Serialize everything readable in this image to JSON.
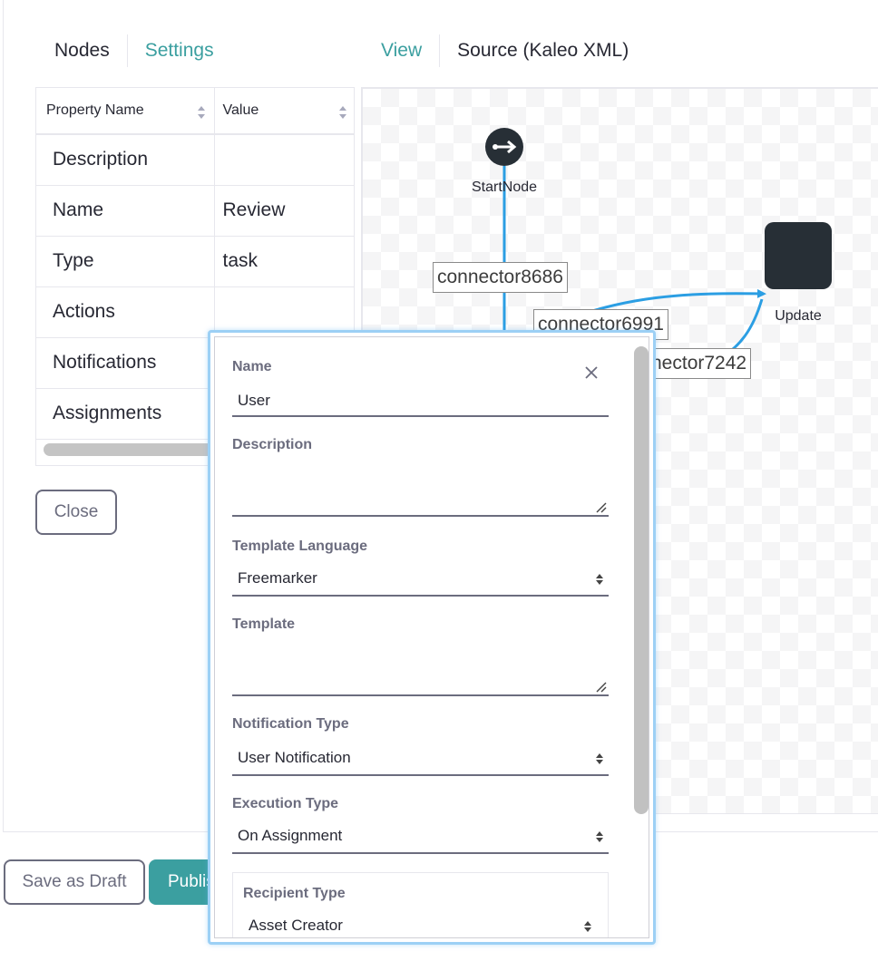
{
  "tabs_left": {
    "nodes": "Nodes",
    "settings": "Settings"
  },
  "tabs_right": {
    "view": "View",
    "source": "Source (Kaleo XML)"
  },
  "properties": {
    "columns": [
      "Property Name",
      "Value"
    ],
    "rows": [
      {
        "name": "Description",
        "value": ""
      },
      {
        "name": "Name",
        "value": "Review"
      },
      {
        "name": "Type",
        "value": "task"
      },
      {
        "name": "Actions",
        "value": ""
      },
      {
        "name": "Notifications",
        "value": ""
      },
      {
        "name": "Assignments",
        "value": ""
      }
    ]
  },
  "close_label": "Close",
  "diagram": {
    "start_label": "StartNode",
    "update_label": "Update",
    "connectors": [
      "connector8686",
      "connector6991",
      "nector7242"
    ],
    "accent": "#2b9ee3"
  },
  "footer": {
    "save_draft": "Save as Draft",
    "publish": "Publis"
  },
  "notification_form": {
    "name_label": "Name",
    "name_value": "User",
    "description_label": "Description",
    "description_value": "",
    "template_language_label": "Template Language",
    "template_language_value": "Freemarker",
    "template_label": "Template",
    "template_value": "",
    "notification_type_label": "Notification Type",
    "notification_type_value": "User Notification",
    "execution_type_label": "Execution Type",
    "execution_type_value": "On Assignment",
    "recipient_type_label": "Recipient Type",
    "recipient_type_value": "Asset Creator"
  }
}
